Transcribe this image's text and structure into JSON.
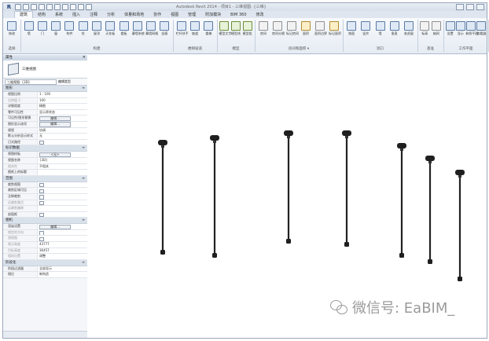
{
  "title_bar": {
    "app_logo": "R",
    "window_title": "Autodesk Revit 2014 - 项目1 - 三维视图: {三维}"
  },
  "ribbon_tabs": [
    "建筑",
    "结构",
    "系统",
    "插入",
    "注释",
    "分析",
    "体量和场地",
    "协作",
    "视图",
    "管理",
    "附加模块",
    "BIM 360",
    "修改"
  ],
  "active_tab_index": 0,
  "ribbon": {
    "panels": [
      {
        "title": "选择",
        "tools": [
          {
            "label": "修改",
            "kind": "b"
          }
        ]
      },
      {
        "title": "构建",
        "tools": [
          {
            "label": "墙",
            "kind": "b"
          },
          {
            "label": "门",
            "kind": "b"
          },
          {
            "label": "窗",
            "kind": "b"
          },
          {
            "label": "构件",
            "kind": "b"
          },
          {
            "label": "柱",
            "kind": "b"
          },
          {
            "label": "屋顶",
            "kind": "b"
          },
          {
            "label": "天花板",
            "kind": "b"
          },
          {
            "label": "楼板",
            "kind": "b"
          },
          {
            "label": "幕墙系统",
            "kind": "b"
          },
          {
            "label": "幕墙网格",
            "kind": "b"
          },
          {
            "label": "竖梃",
            "kind": "b"
          }
        ]
      },
      {
        "title": "楼梯坡道",
        "tools": [
          {
            "label": "栏杆扶手",
            "kind": "b"
          },
          {
            "label": "坡道",
            "kind": "b"
          },
          {
            "label": "楼梯",
            "kind": "b"
          }
        ]
      },
      {
        "title": "模型",
        "tools": [
          {
            "label": "模型文字",
            "kind": "g"
          },
          {
            "label": "模型线",
            "kind": "g"
          },
          {
            "label": "模型组",
            "kind": "g"
          }
        ]
      },
      {
        "title": "房间和面积 ▾",
        "tools": [
          {
            "label": "房间",
            "kind": "x"
          },
          {
            "label": "房间分隔",
            "kind": "x"
          },
          {
            "label": "标记房间",
            "kind": "x"
          },
          {
            "label": "面积",
            "kind": "o"
          },
          {
            "label": "面积边界",
            "kind": "x"
          },
          {
            "label": "标记面积",
            "kind": "o"
          }
        ]
      },
      {
        "title": "洞口",
        "tools": [
          {
            "label": "按面",
            "kind": "b"
          },
          {
            "label": "竖井",
            "kind": "b"
          },
          {
            "label": "墙",
            "kind": "b"
          },
          {
            "label": "垂直",
            "kind": "b"
          },
          {
            "label": "老虎窗",
            "kind": "b"
          }
        ]
      },
      {
        "title": "基准",
        "tools": [
          {
            "label": "标高",
            "kind": "x"
          },
          {
            "label": "轴网",
            "kind": "x"
          }
        ]
      },
      {
        "title": "工作平面",
        "tools": [
          {
            "label": "设置",
            "kind": "b"
          },
          {
            "label": "显示",
            "kind": "b"
          },
          {
            "label": "参照平面",
            "kind": "b"
          },
          {
            "label": "查看器",
            "kind": "b"
          }
        ]
      }
    ],
    "select_label": "选择 ▾"
  },
  "properties": {
    "header": "属性",
    "close": "✕",
    "type_name": "三维视图",
    "filter_value": "三维视图: {3D}",
    "edit_type": "编辑类型",
    "categories": [
      {
        "name": "图形",
        "toggle": "≈",
        "rows": [
          {
            "k": "视图比例",
            "v": "1 : 100"
          },
          {
            "k": "比例值 1:",
            "v": "100",
            "dim": true
          },
          {
            "k": "详细程度",
            "v": "精细"
          },
          {
            "k": "零件可见性",
            "v": "显示原状态"
          },
          {
            "k": "可见性/图形替换",
            "v": "编辑...",
            "btn": true
          },
          {
            "k": "图形显示选项",
            "v": "编辑...",
            "btn": true
          },
          {
            "k": "规程",
            "v": "协调"
          },
          {
            "k": "默认分析显示样式",
            "v": "无"
          },
          {
            "k": "日光路径",
            "v": "",
            "chk": true
          }
        ]
      },
      {
        "name": "标识数据",
        "toggle": "≈",
        "rows": [
          {
            "k": "视图样板",
            "v": "<无>",
            "btn": true
          },
          {
            "k": "视图名称",
            "v": "{3D}"
          },
          {
            "k": "相关性",
            "v": "不相关",
            "dim": true
          },
          {
            "k": "图纸上的标题",
            "v": ""
          }
        ]
      },
      {
        "name": "范围",
        "toggle": "≈",
        "rows": [
          {
            "k": "裁剪视图",
            "v": "",
            "chk": true
          },
          {
            "k": "裁剪区域可见",
            "v": "",
            "chk": true
          },
          {
            "k": "注释裁剪",
            "v": "",
            "chk": true
          },
          {
            "k": "远裁剪激活",
            "v": "",
            "chk": true,
            "dim": true
          },
          {
            "k": "远裁剪偏移",
            "v": "",
            "dim": true
          },
          {
            "k": "剖面框",
            "v": "",
            "chk": true
          }
        ]
      },
      {
        "name": "相机",
        "toggle": "≈",
        "rows": [
          {
            "k": "渲染设置",
            "v": "编辑...",
            "btn": true
          },
          {
            "k": "锁定的方向",
            "v": "",
            "chk": true,
            "dim": true
          },
          {
            "k": "透视图",
            "v": "",
            "chk": true,
            "dim": true
          },
          {
            "k": "视点高度",
            "v": "43777",
            "dim": true
          },
          {
            "k": "目标高度",
            "v": "36457",
            "dim": true
          },
          {
            "k": "相机位置",
            "v": "调整",
            "dim": true
          }
        ]
      },
      {
        "name": "阶段化",
        "toggle": "≈",
        "rows": [
          {
            "k": "阶段过滤器",
            "v": "全部显示"
          },
          {
            "k": "相位",
            "v": "新构造"
          }
        ]
      }
    ]
  },
  "watermark": {
    "text": "微信号: EaBIM_"
  }
}
